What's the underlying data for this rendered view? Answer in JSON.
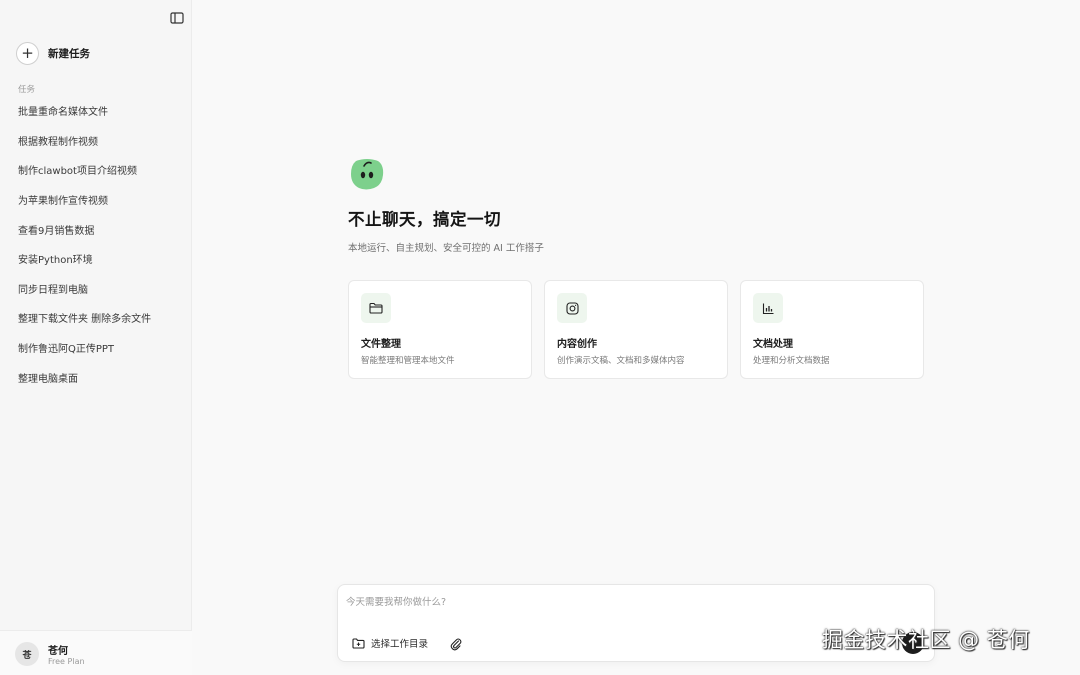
{
  "sidebar": {
    "new_task_label": "新建任务",
    "section_label": "任务",
    "tasks": [
      "批量重命名媒体文件",
      "根据教程制作视频",
      "制作clawbot项目介绍视频",
      "为苹果制作宣传视频",
      "查看9月销售数据",
      "安装Python环境",
      "同步日程到电脑",
      "整理下载文件夹 删除多余文件",
      "制作鲁迅阿Q正传PPT",
      "整理电脑桌面"
    ],
    "user": {
      "avatar_text": "苍",
      "name": "苍何",
      "plan": "Free Plan"
    }
  },
  "hero": {
    "title": "不止聊天，搞定一切",
    "subtitle": "本地运行、自主规划、安全可控的 AI 工作搭子"
  },
  "cards": [
    {
      "icon": "folder-icon",
      "title": "文件整理",
      "desc": "智能整理和管理本地文件"
    },
    {
      "icon": "instagram-icon",
      "title": "内容创作",
      "desc": "创作演示文稿、文档和多媒体内容"
    },
    {
      "icon": "bar-chart-icon",
      "title": "文档处理",
      "desc": "处理和分析文档数据"
    }
  ],
  "composer": {
    "placeholder": "今天需要我帮你做什么?",
    "dir_label": "选择工作目录"
  },
  "watermark": "掘金技术社区 @ 苍何",
  "colors": {
    "accent_green": "#7dd08c",
    "card_icon_bg": "#eef6ee"
  }
}
